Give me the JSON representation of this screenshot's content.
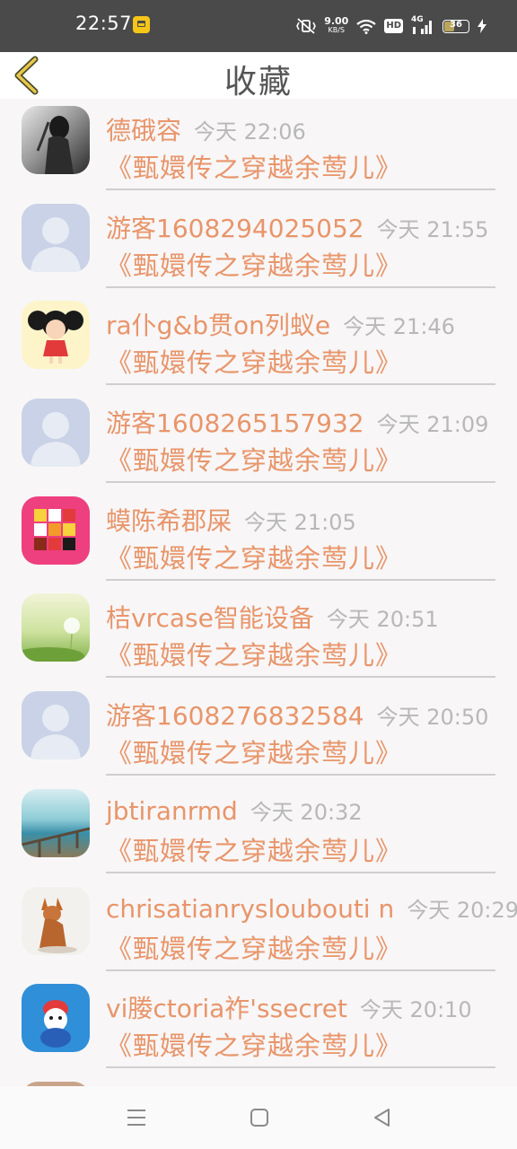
{
  "status_bar": {
    "time": "22:57",
    "speed_value": "9.00",
    "speed_unit": "KB/S",
    "network": "4G",
    "hd": "HD",
    "battery": "36"
  },
  "header": {
    "title": "收藏"
  },
  "favorites": [
    {
      "username": "德硪容",
      "time": "今天 22:06",
      "book": "《甄嬛传之穿越余莺儿》",
      "avatar": "photo-girl-bw-icon"
    },
    {
      "username": "游客1608294025052",
      "time": "今天 21:55",
      "book": "《甄嬛传之穿越余莺儿》",
      "avatar": "default-user-icon"
    },
    {
      "username": "ra仆g&b贯on列蚁e",
      "time": "今天 21:46",
      "book": "《甄嬛传之穿越余莺儿》",
      "avatar": "cartoon-girl-icon"
    },
    {
      "username": "游客1608265157932",
      "time": "今天 21:09",
      "book": "《甄嬛传之穿越余莺儿》",
      "avatar": "default-user-icon"
    },
    {
      "username": "蟆陈希郡屎",
      "time": "今天 21:05",
      "book": "《甄嬛传之穿越余莺儿》",
      "avatar": "rubik-cube-icon"
    },
    {
      "username": "桔vrcase智能设备",
      "time": "今天 20:51",
      "book": "《甄嬛传之穿越余莺儿》",
      "avatar": "dandelion-field-icon"
    },
    {
      "username": "游客1608276832584",
      "time": "今天 20:50",
      "book": "《甄嬛传之穿越余莺儿》",
      "avatar": "default-user-icon"
    },
    {
      "username": "jbtiranrmd",
      "time": "今天 20:32",
      "book": "《甄嬛传之穿越余莺儿》",
      "avatar": "seaside-fence-icon"
    },
    {
      "username": "chrisatianrysloubouti n",
      "time": "今天 20:29",
      "book": "《甄嬛传之穿越余莺儿》",
      "avatar": "dog-figurine-icon"
    },
    {
      "username": "vi媵ctoria祚'ssecret",
      "time": "今天 20:10",
      "book": "《甄嬛传之穿越余莺儿》",
      "avatar": "cartoon-mascot-icon"
    }
  ],
  "colors": {
    "accent": "#e8956a",
    "time_gray": "#b8b8b8",
    "status_bar": "#4a4a4a"
  }
}
